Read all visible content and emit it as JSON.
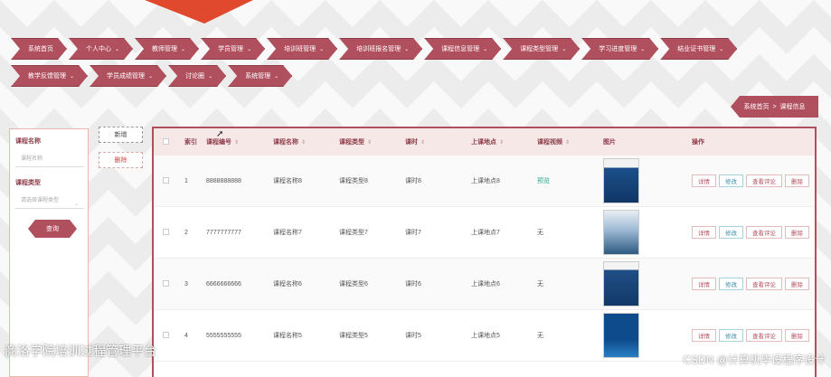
{
  "nav": {
    "row1": [
      {
        "label": "系统首页",
        "has_menu": false
      },
      {
        "label": "个人中心",
        "has_menu": true
      },
      {
        "label": "教师管理",
        "has_menu": true
      },
      {
        "label": "学员管理",
        "has_menu": true
      },
      {
        "label": "培训班管理",
        "has_menu": true
      },
      {
        "label": "培训班报名管理",
        "has_menu": true
      },
      {
        "label": "课程信息管理",
        "has_menu": true
      },
      {
        "label": "课程类型管理",
        "has_menu": true
      },
      {
        "label": "学习进度管理",
        "has_menu": true
      },
      {
        "label": "结业证书管理",
        "has_menu": true
      }
    ],
    "row2": [
      {
        "label": "教学反馈管理",
        "has_menu": true
      },
      {
        "label": "学员成绩管理",
        "has_menu": true
      },
      {
        "label": "讨论圈",
        "has_menu": true
      },
      {
        "label": "系统管理",
        "has_menu": true
      }
    ],
    "chevron": "⌄"
  },
  "breadcrumb": {
    "home": "系统首页",
    "sep": ">",
    "current": "课程信息"
  },
  "search": {
    "name_label": "课程名称",
    "name_placeholder": "课程名称",
    "type_label": "课程类型",
    "type_placeholder": "请选择课程类型",
    "button": "查询"
  },
  "actions": {
    "add": "新增",
    "delete": "删除"
  },
  "table": {
    "headers": [
      "",
      "索引",
      "课程编号",
      "课程名称",
      "课程类型",
      "课时",
      "上课地点",
      "课程视频",
      "图片",
      "操作"
    ],
    "sort_icon": "⇕",
    "rows": [
      {
        "index": "1",
        "code": "8888888888",
        "name": "课程名称8",
        "type": "课程类型8",
        "hours": "课时8",
        "place": "上课地点8",
        "video": "预览",
        "img": "book-cover-1"
      },
      {
        "index": "2",
        "code": "7777777777",
        "name": "课程名称7",
        "type": "课程类型7",
        "hours": "课时7",
        "place": "上课地点7",
        "video": "无",
        "img": "book-cover-2"
      },
      {
        "index": "3",
        "code": "6666666666",
        "name": "课程名称6",
        "type": "课程类型6",
        "hours": "课时6",
        "place": "上课地点6",
        "video": "无",
        "img": "book-cover-3"
      },
      {
        "index": "4",
        "code": "5555555555",
        "name": "课程名称5",
        "type": "课程类型5",
        "hours": "课时5",
        "place": "上课地点5",
        "video": "无",
        "img": "book-cover-4"
      }
    ],
    "ops": {
      "detail": "详情",
      "edit": "修改",
      "review": "查看评论",
      "delete": "删除"
    }
  },
  "overlay_title": "商洛学院培训过程管理平台",
  "watermark": "CSDN @计算机毕设程序设计",
  "colors": {
    "accent": "#b0505e",
    "accent_dark": "#8d3c48",
    "top_deco": "#e0492e",
    "link": "#2aa58a"
  }
}
